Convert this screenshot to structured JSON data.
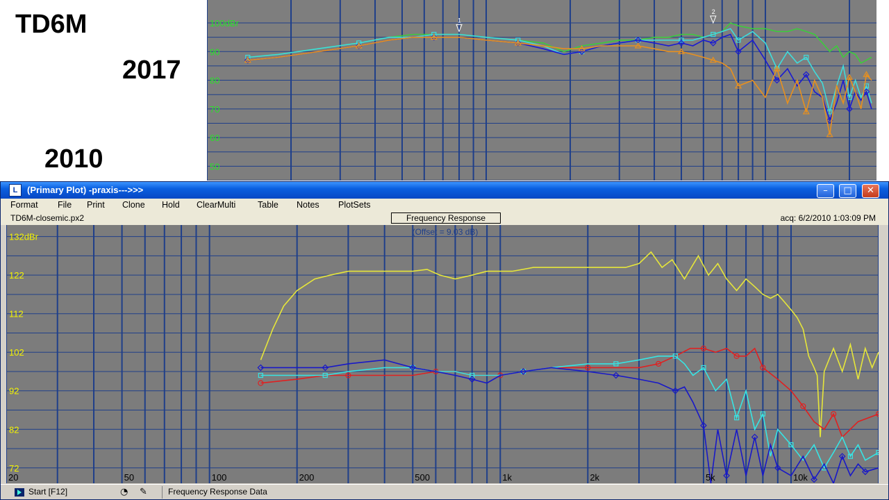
{
  "slide": {
    "model_label": "TD6M",
    "year_top": "2017",
    "year_bottom": "2010"
  },
  "window": {
    "app_icon": "L",
    "title": "(Primary Plot) -praxis--->>>",
    "min_glyph": "–",
    "max_glyph": "□",
    "close_glyph": "✕",
    "menu": [
      "Format",
      "File",
      "Print",
      "Clone",
      "Hold",
      "ClearMulti",
      "Table",
      "Notes",
      "PlotSets"
    ],
    "file_name": "TD6M-closemic.px2",
    "plot_title": "Frequency Response",
    "plot_subtitle": "(Offset = 9.03 dB)",
    "acq": "acq: 6/2/2010 1:03:09 PM",
    "status_start": "Start [F12]",
    "status_icon_a": "◔",
    "status_icon_b": "✎",
    "status_text": "Frequency Response Data"
  },
  "colors": {
    "plot_bg": "#7c7c7c",
    "grid": "#1f3f8a",
    "axis_label_top": "#2adf2a",
    "axis_label_bottom": "#f2f200"
  },
  "chart_data": [
    {
      "type": "line",
      "xscale": "log",
      "xlim": [
        100,
        25000
      ],
      "ylim": [
        45,
        108
      ],
      "yticks": [
        50,
        60,
        70,
        80,
        90
      ],
      "ytick_labels": [
        "50",
        "60",
        "70",
        "80",
        "90"
      ],
      "ytop_label": "100dBr",
      "ytop_value": 100,
      "grid": true,
      "markers": [
        {
          "label": "1",
          "x": 800,
          "y": 97
        },
        {
          "label": "2",
          "x": 6500,
          "y": 100
        }
      ],
      "series": [
        {
          "color": "#3ccc3c",
          "x": [
            140,
            180,
            250,
            350,
            450,
            550,
            650,
            800,
            1000,
            1300,
            1600,
            1900,
            2200,
            2600,
            3000,
            3500,
            4000,
            4500,
            5000,
            5500,
            6000,
            6500,
            7000,
            7500,
            8000,
            9000,
            10000,
            11000,
            12000,
            13000,
            14000,
            15000,
            16000,
            17000,
            18000,
            19000,
            20000,
            21000,
            22000,
            23000,
            24000
          ],
          "y": [
            88,
            89,
            91,
            93,
            95,
            96,
            96,
            96,
            95,
            94,
            93,
            90,
            92,
            93,
            94,
            94,
            95,
            95,
            96,
            96,
            95,
            96,
            97,
            100,
            99,
            98,
            98,
            97,
            97,
            98,
            97,
            96,
            93,
            90,
            92,
            88,
            90,
            89,
            86,
            87,
            88
          ]
        },
        {
          "color": "#3fdcdc",
          "x": [
            140,
            180,
            250,
            350,
            450,
            550,
            650,
            800,
            1000,
            1300,
            1600,
            1900,
            2200,
            2600,
            3000,
            3500,
            4000,
            4500,
            5000,
            5500,
            6000,
            6500,
            7000,
            7500,
            8000,
            9000,
            10000,
            11000,
            12000,
            13000,
            14000,
            15000,
            16000,
            17000,
            18000,
            19000,
            20000,
            21000,
            22000,
            23000,
            24000
          ],
          "y": [
            88,
            89,
            91,
            93,
            95,
            95,
            96,
            96,
            95,
            94,
            92,
            89,
            90,
            92,
            93,
            94,
            94,
            94,
            94,
            94,
            95,
            96,
            97,
            98,
            94,
            97,
            93,
            84,
            90,
            86,
            88,
            83,
            79,
            69,
            78,
            85,
            74,
            80,
            74,
            78,
            72
          ]
        },
        {
          "color": "#1a1ad2",
          "x": [
            140,
            180,
            250,
            350,
            450,
            550,
            650,
            800,
            1000,
            1300,
            1600,
            1900,
            2200,
            2600,
            3000,
            3500,
            4000,
            4500,
            5000,
            5500,
            6000,
            6500,
            7000,
            7500,
            8000,
            9000,
            10000,
            11000,
            12000,
            13000,
            14000,
            15000,
            16000,
            17000,
            18000,
            19000,
            20000,
            21000,
            22000,
            23000,
            24000
          ],
          "y": [
            87,
            88,
            90,
            92,
            94,
            95,
            95,
            95,
            94,
            93,
            91,
            89,
            90,
            92,
            93,
            94,
            93,
            92,
            93,
            92,
            94,
            93,
            95,
            96,
            90,
            94,
            87,
            80,
            84,
            78,
            82,
            76,
            74,
            66,
            72,
            80,
            70,
            76,
            73,
            76,
            70
          ]
        },
        {
          "color": "#e8901e",
          "x": [
            140,
            180,
            250,
            350,
            450,
            550,
            650,
            800,
            1000,
            1300,
            1600,
            1900,
            2200,
            2600,
            3000,
            3500,
            4000,
            4500,
            5000,
            5500,
            6000,
            6500,
            7000,
            7500,
            8000,
            9000,
            10000,
            11000,
            12000,
            13000,
            14000,
            15000,
            16000,
            17000,
            18000,
            19000,
            20000,
            21000,
            22000,
            23000,
            24000
          ],
          "y": [
            87,
            88,
            90,
            92,
            94,
            95,
            95,
            95,
            94,
            93,
            92,
            91,
            91,
            92,
            92,
            92,
            91,
            90,
            90,
            89,
            88,
            87,
            86,
            84,
            78,
            80,
            74,
            84,
            72,
            80,
            69,
            80,
            74,
            61,
            78,
            72,
            81,
            76,
            70,
            82,
            80
          ]
        }
      ]
    },
    {
      "type": "line",
      "xscale": "log",
      "xlim": [
        20,
        20000
      ],
      "ylim": [
        68,
        135
      ],
      "xticks": [
        20,
        50,
        100,
        200,
        500,
        1000,
        2000,
        5000,
        10000
      ],
      "xtick_labels": [
        "20",
        "50",
        "100",
        "200",
        "500",
        "1k",
        "2k",
        "5k",
        "10k"
      ],
      "yticks": [
        72,
        82,
        92,
        102,
        112,
        122
      ],
      "ytick_labels": [
        "72",
        "82",
        "92",
        "102",
        "112",
        "122"
      ],
      "ytop_label": "132dBr",
      "ytop_value": 132,
      "grid": true,
      "series": [
        {
          "color": "#e6e63a",
          "x": [
            150,
            165,
            180,
            200,
            230,
            260,
            300,
            350,
            420,
            500,
            560,
            620,
            700,
            800,
            900,
            1000,
            1100,
            1300,
            1500,
            1800,
            2200,
            2700,
            3000,
            3300,
            3600,
            3900,
            4300,
            4800,
            5200,
            5600,
            6000,
            6500,
            7000,
            7500,
            8000,
            8500,
            9000,
            9500,
            10000,
            10500,
            11000,
            11500,
            12000,
            12300,
            12600,
            13000,
            14000,
            15000,
            16000,
            17000,
            18000,
            19000,
            20000
          ],
          "y": [
            100,
            108,
            114,
            118,
            121,
            122,
            123,
            123,
            123,
            123,
            123.5,
            122,
            121,
            122,
            123,
            123,
            123,
            124,
            124,
            124,
            124,
            124,
            125,
            128,
            124,
            126,
            121,
            127,
            122,
            125,
            121,
            118,
            121,
            119,
            117,
            116,
            117,
            115,
            113,
            111,
            108,
            101,
            98,
            96,
            80,
            97,
            103,
            97,
            104,
            95,
            103,
            98,
            102
          ]
        },
        {
          "color": "#e02020",
          "x": [
            150,
            200,
            250,
            300,
            400,
            500,
            600,
            700,
            800,
            1000,
            1200,
            1500,
            2000,
            2500,
            3000,
            3500,
            4000,
            4500,
            5000,
            5500,
            6000,
            6500,
            7000,
            7500,
            8000,
            9000,
            10000,
            11000,
            12000,
            13000,
            14000,
            15000,
            17000,
            20000
          ],
          "y": [
            94,
            95,
            96,
            96,
            96,
            96,
            97,
            97,
            96,
            96,
            97,
            98,
            98,
            98,
            98,
            99,
            101,
            103,
            103,
            102,
            103,
            101,
            101,
            103,
            98,
            95,
            92,
            88,
            84,
            82,
            86,
            80,
            84,
            86
          ]
        },
        {
          "color": "#37e4e4",
          "x": [
            150,
            180,
            200,
            250,
            300,
            400,
            500,
            600,
            700,
            800,
            900,
            1000,
            1200,
            1500,
            2000,
            2500,
            3000,
            3500,
            4000,
            4300,
            4600,
            5000,
            5500,
            6000,
            6500,
            7000,
            7500,
            8000,
            8500,
            9000,
            10000,
            11000,
            12000,
            13000,
            14000,
            15000,
            16000,
            17000,
            18000,
            20000
          ],
          "y": [
            96,
            96,
            96,
            96,
            97,
            98,
            98,
            97,
            97,
            96,
            96,
            96,
            97,
            98,
            99,
            99,
            100,
            101,
            101,
            99,
            96,
            98,
            92,
            95,
            85,
            92,
            82,
            86,
            75,
            82,
            78,
            74,
            78,
            72,
            76,
            80,
            75,
            78,
            74,
            76
          ]
        },
        {
          "color": "#1818c8",
          "x": [
            150,
            180,
            200,
            250,
            300,
            400,
            500,
            600,
            700,
            800,
            900,
            1000,
            1200,
            1500,
            2000,
            2500,
            3000,
            3500,
            4000,
            4300,
            4600,
            5000,
            5300,
            5600,
            6000,
            6500,
            7000,
            7500,
            8000,
            8500,
            9000,
            10000,
            11000,
            12000,
            13000,
            14000,
            15000,
            16000,
            17000,
            18000,
            20000
          ],
          "y": [
            98,
            98,
            98,
            98,
            99,
            100,
            98,
            97,
            96,
            95,
            94,
            96,
            97,
            98,
            97,
            96,
            95,
            94,
            92,
            93,
            89,
            83,
            68,
            82,
            70,
            82,
            70,
            80,
            70,
            78,
            72,
            70,
            75,
            69,
            73,
            68,
            75,
            70,
            73,
            71,
            72
          ]
        }
      ]
    }
  ]
}
